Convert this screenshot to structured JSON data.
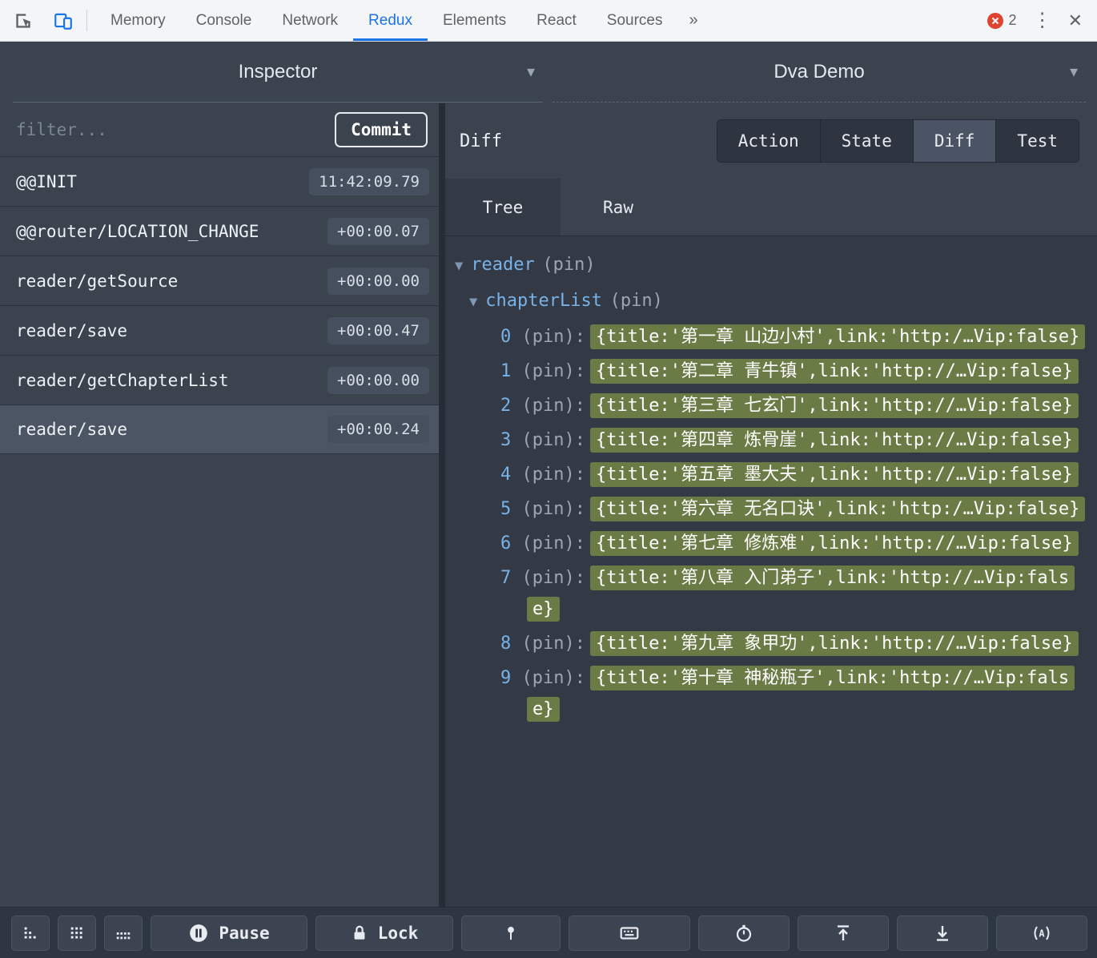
{
  "glyphs": {
    "dropdown_arrow": "▾",
    "collapse_arrow": "▼",
    "kebab": "⋮",
    "close": "✕",
    "chevron_more": "»"
  },
  "devtools": {
    "tabs": [
      "Memory",
      "Console",
      "Network",
      "Redux",
      "Elements",
      "React",
      "Sources"
    ],
    "active_tab": "Redux",
    "error_count": "2"
  },
  "header": {
    "monitor_select": "Inspector",
    "instance_select": "Dva Demo"
  },
  "action_list": {
    "filter_placeholder": "filter...",
    "commit_button": "Commit",
    "selected_index": 5,
    "actions": [
      {
        "name": "@@INIT",
        "time": "11:42:09.79"
      },
      {
        "name": "@@router/LOCATION_CHANGE",
        "time": "+00:00.07"
      },
      {
        "name": "reader/getSource",
        "time": "+00:00.00"
      },
      {
        "name": "reader/save",
        "time": "+00:00.47"
      },
      {
        "name": "reader/getChapterList",
        "time": "+00:00.00"
      },
      {
        "name": "reader/save",
        "time": "+00:00.24"
      }
    ]
  },
  "inspector": {
    "panel_label": "Diff",
    "tabs": [
      "Action",
      "State",
      "Diff",
      "Test"
    ],
    "active_tab": "Diff",
    "view_tabs": [
      "Tree",
      "Raw"
    ],
    "active_view": "Tree",
    "diff_tree": {
      "root_key": "reader",
      "root_pin": "(pin)",
      "child_key": "chapterList",
      "child_pin": "(pin)",
      "items": [
        {
          "index": "0",
          "label": "(pin):",
          "value": "{title:'第一章 山边小村',link:'http:/…Vip:false}"
        },
        {
          "index": "1",
          "label": "(pin):",
          "value": "{title:'第二章 青牛镇',link:'http://…Vip:false}"
        },
        {
          "index": "2",
          "label": "(pin):",
          "value": "{title:'第三章 七玄门',link:'http://…Vip:false}"
        },
        {
          "index": "3",
          "label": "(pin):",
          "value": "{title:'第四章 炼骨崖',link:'http://…Vip:false}"
        },
        {
          "index": "4",
          "label": "(pin):",
          "value": "{title:'第五章 墨大夫',link:'http://…Vip:false}"
        },
        {
          "index": "5",
          "label": "(pin):",
          "value": "{title:'第六章 无名口诀',link:'http:/…Vip:false}"
        },
        {
          "index": "6",
          "label": "(pin):",
          "value": "{title:'第七章 修炼难',link:'http://…Vip:false}"
        },
        {
          "index": "7",
          "label": "(pin):",
          "value": "{title:'第八章 入门弟子',link:'http://…Vip:false}"
        },
        {
          "index": "8",
          "label": "(pin):",
          "value": "{title:'第九章 象甲功',link:'http://…Vip:false}"
        },
        {
          "index": "9",
          "label": "(pin):",
          "value": "{title:'第十章 神秘瓶子',link:'http://…Vip:false}"
        }
      ]
    }
  },
  "footer": {
    "pause_label": "Pause",
    "lock_label": "Lock"
  },
  "colors": {
    "accent_blue": "#1a73e8",
    "key_blue": "#79b2e6",
    "diff_added_bg": "#6b7b45",
    "panel_base": "#3b434f",
    "panel_content": "#333a45",
    "error_red": "#e0432f"
  }
}
